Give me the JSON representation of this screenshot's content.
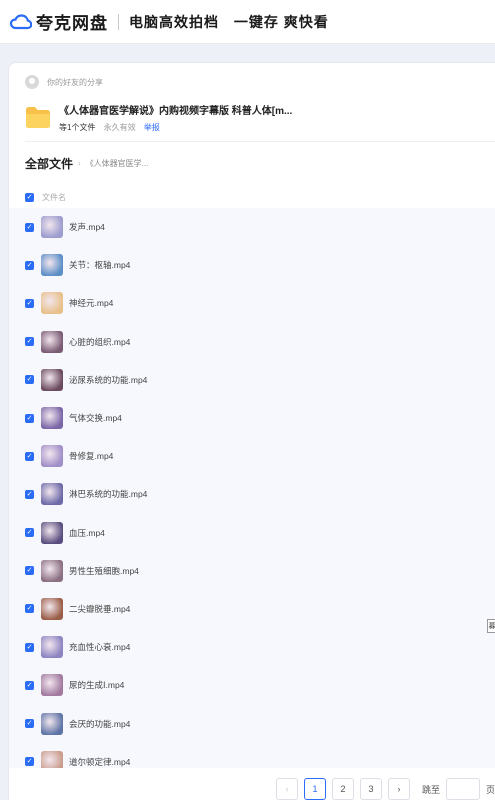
{
  "header": {
    "brand": "夸克网盘",
    "slogan_1": "电脑高效拍档",
    "slogan_2": "一键存 爽快看",
    "brand_color": "#2a6cf6"
  },
  "share": {
    "from_text": "你的好友的分享",
    "folder_title": "《人体器官医学解说》内购视频字幕版 科普人体[m...",
    "file_count": "等1个文件",
    "expire": "永久有效",
    "report": "举报"
  },
  "breadcrumb": {
    "all_files": "全部文件",
    "arrow": "›",
    "current": "《人体器官医学..."
  },
  "list": {
    "header_label": "文件名",
    "items": [
      {
        "name": "发声.mp4",
        "thumb": "#9c9ccf"
      },
      {
        "name": "关节：枢轴.mp4",
        "thumb": "#5d8fc7"
      },
      {
        "name": "神经元.mp4",
        "thumb": "#e8c08a"
      },
      {
        "name": "心脏的组织.mp4",
        "thumb": "#7a5b74"
      },
      {
        "name": "泌尿系统的功能.mp4",
        "thumb": "#6a4a5e"
      },
      {
        "name": "气体交换.mp4",
        "thumb": "#7b66a8"
      },
      {
        "name": "骨修复.mp4",
        "thumb": "#a08fc8"
      },
      {
        "name": "淋巴系统的功能.mp4",
        "thumb": "#6d6aa8"
      },
      {
        "name": "血压.mp4",
        "thumb": "#5a4e80"
      },
      {
        "name": "男性生殖细胞.mp4",
        "thumb": "#8b6f83"
      },
      {
        "name": "二尖瓣脱垂.mp4",
        "thumb": "#9a5e48"
      },
      {
        "name": "充血性心衰.mp4",
        "thumb": "#8d84c2"
      },
      {
        "name": "尿的生成Ⅰ.mp4",
        "thumb": "#a27aa0"
      },
      {
        "name": "会厌的功能.mp4",
        "thumb": "#5f74a6"
      },
      {
        "name": "道尔顿定律.mp4",
        "thumb": "#c99b8a"
      }
    ]
  },
  "tooltip_text": "募",
  "pagination": {
    "prev": "‹",
    "pages": [
      "1",
      "2",
      "3"
    ],
    "current": "1",
    "next": "›",
    "jump_label": "跳至",
    "jump_value": "",
    "page_unit": "页"
  }
}
